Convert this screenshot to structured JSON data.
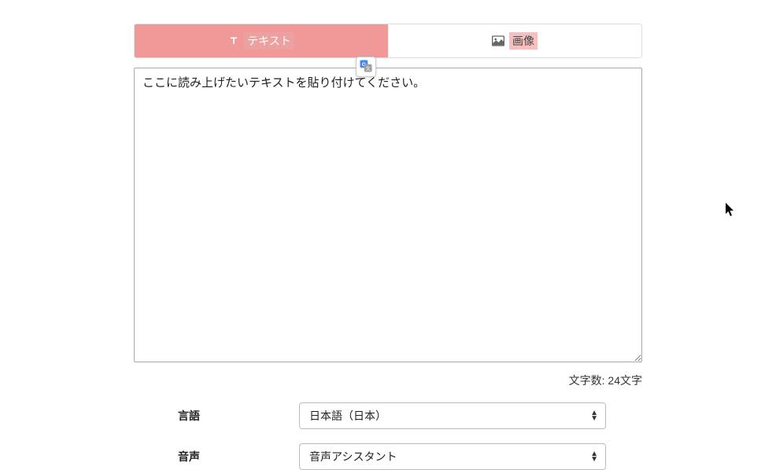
{
  "tabs": {
    "text": {
      "label": "テキスト",
      "icon": "font-icon"
    },
    "image": {
      "label": "画像",
      "icon": "image-icon"
    }
  },
  "textarea": {
    "value": "ここに読み上げたいテキストを貼り付けてください。"
  },
  "translate_badge": {
    "icon": "translate-icon"
  },
  "char_count": {
    "prefix": "文字数: ",
    "count": "24",
    "suffix": "文字"
  },
  "form": {
    "language": {
      "label": "言語",
      "selected": "日本語（日本）"
    },
    "voice": {
      "label": "音声",
      "selected": "音声アシスタント"
    }
  }
}
